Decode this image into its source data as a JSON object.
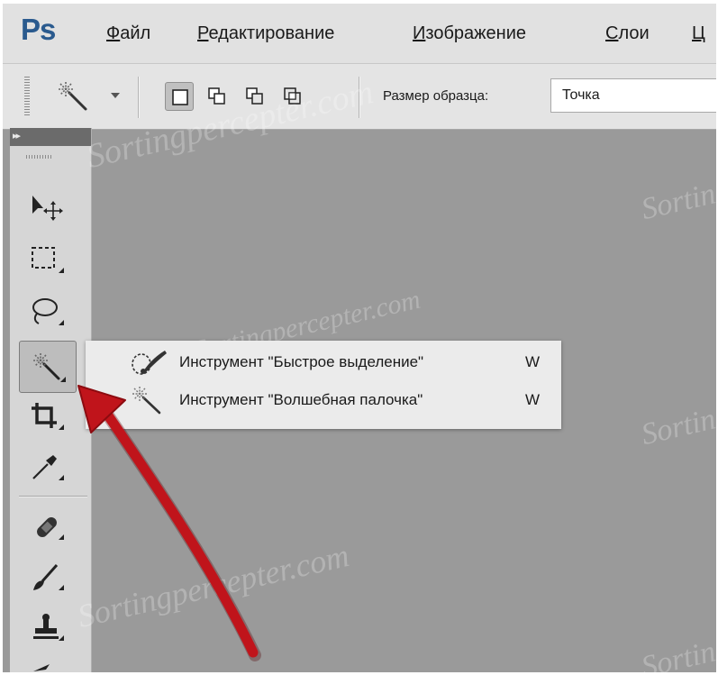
{
  "app": {
    "logo": "Ps"
  },
  "menu": {
    "items": [
      {
        "mnemonic": "Ф",
        "rest": "айл"
      },
      {
        "mnemonic": "Р",
        "rest": "едактирование"
      },
      {
        "mnemonic": "И",
        "rest": "зображение"
      },
      {
        "mnemonic": "С",
        "rest": "лои"
      },
      {
        "mnemonic": "Ц",
        "rest": ""
      }
    ]
  },
  "options": {
    "sample_size_label": "Размер образца:",
    "sample_size_value": "Точка",
    "active_mode": "new-selection"
  },
  "toolbar": {
    "collapse_glyph": "▸▸",
    "active_tool": "magic-wand"
  },
  "flyout": {
    "items": [
      {
        "label": "Инструмент \"Быстрое выделение\"",
        "key": "W",
        "selected": false
      },
      {
        "label": "Инструмент \"Волшебная палочка\"",
        "key": "W",
        "selected": true
      }
    ]
  },
  "watermark": {
    "text": "Sortingpercepter.com"
  },
  "colors": {
    "canvas": "#9a9a9a",
    "ui": "#e1e1e1",
    "ps_blue": "#2a5a8e",
    "arrow": "#c0141b"
  }
}
